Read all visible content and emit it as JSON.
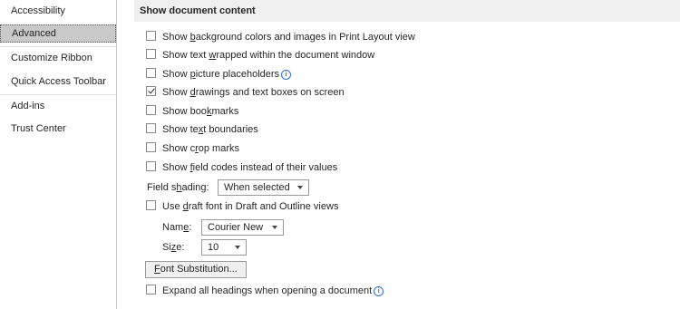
{
  "sidebar": {
    "items": [
      {
        "label": "Accessibility"
      },
      {
        "label": "Advanced"
      },
      {
        "label": "Customize Ribbon"
      },
      {
        "label": "Quick Access Toolbar"
      },
      {
        "label": "Add-ins"
      },
      {
        "label": "Trust Center"
      }
    ],
    "selected": "Advanced"
  },
  "section": {
    "title": "Show document content"
  },
  "options": {
    "bg_colors": {
      "pre": "Show ",
      "key": "b",
      "post": "ackground colors and images in Print Layout view",
      "checked": false
    },
    "text_wrapped": {
      "pre": "Show text ",
      "key": "w",
      "post": "rapped within the document window",
      "checked": false
    },
    "picture_placeholders": {
      "pre": "Show ",
      "key": "p",
      "post": "icture placeholders",
      "checked": false
    },
    "drawings": {
      "pre": "Show ",
      "key": "d",
      "post": "rawings and text boxes on screen",
      "checked": true
    },
    "bookmarks": {
      "pre": "Show boo",
      "key": "k",
      "post": "marks",
      "checked": false
    },
    "text_boundaries": {
      "pre": "Show te",
      "key": "x",
      "post": "t boundaries",
      "checked": false
    },
    "crop_marks": {
      "pre": "Show c",
      "key": "r",
      "post": "op marks",
      "checked": false
    },
    "field_codes": {
      "pre": "Show ",
      "key": "f",
      "post": "ield codes instead of their values",
      "checked": false
    },
    "draft_font": {
      "pre": "Use ",
      "key": "d",
      "post": "raft font in Draft and Outline views",
      "checked": false
    },
    "expand_headings": {
      "label": "Expand all headings when opening a document",
      "checked": false
    }
  },
  "field_shading": {
    "pre": "Field s",
    "key": "h",
    "post": "ading:",
    "value": "When selected"
  },
  "draft_name": {
    "pre": "Nam",
    "key": "e",
    "post": ":",
    "value": "Courier New"
  },
  "draft_size": {
    "pre": "Si",
    "key": "z",
    "post": "e:",
    "value": "10"
  },
  "font_substitution": {
    "key": "F",
    "post": "ont Substitution..."
  },
  "info_glyph": "i"
}
